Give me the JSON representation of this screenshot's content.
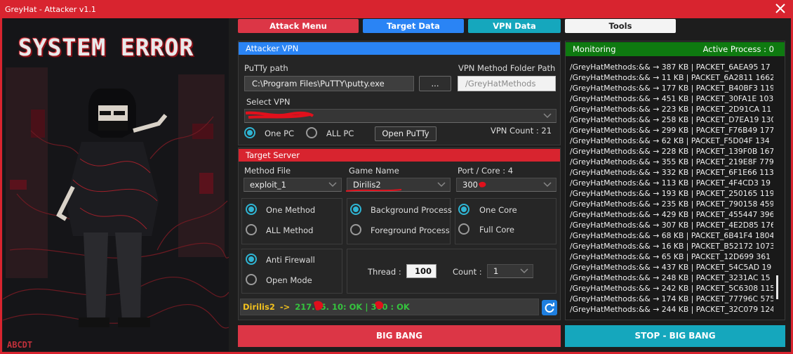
{
  "window": {
    "title": "GreyHat - Attacker v1.1"
  },
  "art": {
    "sign_text": "SYSTEM ERROR",
    "corner_tag": "ABCDT"
  },
  "tabs": [
    {
      "label": "Attack Menu",
      "color": "#dc3646"
    },
    {
      "label": "Target Data",
      "color": "#2a84f5"
    },
    {
      "label": "VPN Data",
      "color": "#15a7bd"
    },
    {
      "label": "Tools",
      "color": "#f4f4f4"
    }
  ],
  "attacker_vpn": {
    "header": "Attacker VPN",
    "putty_label": "PuTTy path",
    "putty_value": "C:\\Program Files\\PuTTY\\putty.exe",
    "browse_label": "...",
    "vpn_folder_label": "VPN Method Folder Path",
    "vpn_folder_placeholder": "/GreyHatMethods",
    "select_label": "Select VPN",
    "select_value": "",
    "one_pc": "One PC",
    "all_pc": "ALL PC",
    "open_putty": "Open PuTTy",
    "vpn_count_label": "VPN Count : 21"
  },
  "target_server": {
    "header": "Target Server",
    "method_label": "Method File",
    "method_value": "exploit_1",
    "game_label": "Game Name",
    "game_value": "Dirilis2",
    "port_label": "Port / Core : 4",
    "port_value": "300",
    "one_method": "One Method",
    "all_method": "ALL Method",
    "background": "Background Process",
    "foreground": "Foreground Process",
    "one_core": "One Core",
    "full_core": "Full Core",
    "anti_firewall": "Anti Firewall",
    "open_mode": "Open Mode",
    "thread_label": "Thread :",
    "thread_value": "100",
    "count_label": "Count :",
    "count_value": "1",
    "status_name": "Dirilis2",
    "status_arrow": "->",
    "status_rest": "217.65.  10: OK | 300  : OK"
  },
  "monitoring": {
    "header": "Monitoring",
    "active": "Active Process : 0",
    "lines": [
      "/GreyHatMethods:&& → 387 KB | PACKET_6AEA95  17",
      "/GreyHatMethods:&& → 11 KB | PACKET_6A2811  1662",
      "/GreyHatMethods:&& → 177 KB | PACKET_B40BF3  119",
      "/GreyHatMethods:&& → 451 KB | PACKET_30FA1E  103",
      "/GreyHatMethods:&& → 223 KB | PACKET_2D91CA  11",
      "/GreyHatMethods:&& → 258 KB | PACKET_D7EA19  130",
      "/GreyHatMethods:&& → 299 KB | PACKET_F76B49  177",
      "/GreyHatMethods:&& → 62 KB | PACKET_F5D04F  134",
      "/GreyHatMethods:&& → 228 KB | PACKET_139F0B  167",
      "/GreyHatMethods:&& → 355 KB | PACKET_219E8F  779",
      "/GreyHatMethods:&& → 332 KB | PACKET_6F1E66  113",
      "/GreyHatMethods:&& → 113 KB | PACKET_4F4CD3  19",
      "/GreyHatMethods:&& → 193 KB | PACKET_250165  119",
      "/GreyHatMethods:&& → 235 KB | PACKET_790158  459",
      "/GreyHatMethods:&& → 429 KB | PACKET_455447  396",
      "/GreyHatMethods:&& → 307 KB | PACKET_4E2D85  176",
      "/GreyHatMethods:&& → 68 KB | PACKET_6B41F4  1804",
      "/GreyHatMethods:&& → 16 KB | PACKET_B52172  1073",
      "/GreyHatMethods:&& → 65 KB | PACKET_12D699  361",
      "/GreyHatMethods:&& → 437 KB | PACKET_54C5AD  19",
      "/GreyHatMethods:&& → 248 KB | PACKET_3231AC  15",
      "/GreyHatMethods:&& → 242 KB | PACKET_5C6308  115",
      "/GreyHatMethods:&& → 174 KB | PACKET_77796C  575",
      "/GreyHatMethods:&& → 244 KB | PACKET_32C079  124"
    ]
  },
  "actions": {
    "big_bang": "BIG BANG",
    "stop": "STOP - BIG BANG"
  }
}
